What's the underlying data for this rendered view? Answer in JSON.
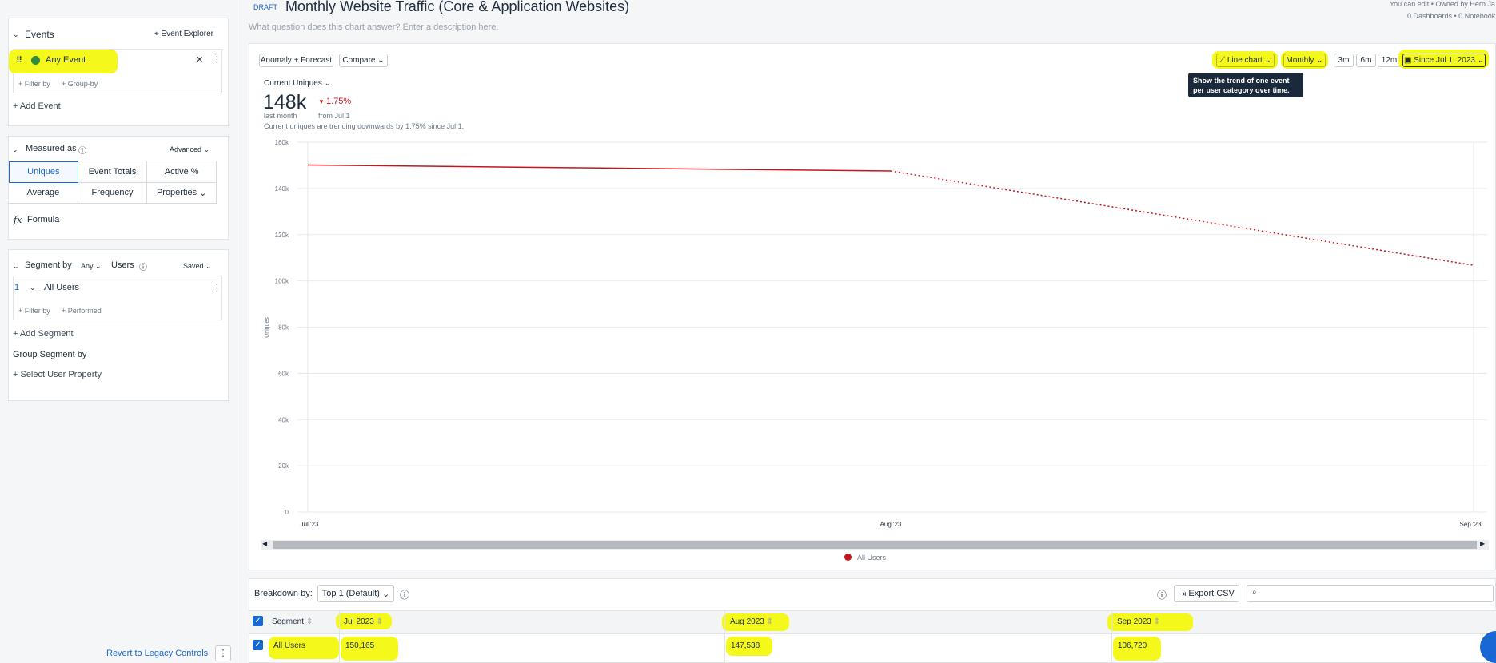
{
  "sidebar": {
    "events_title": "Events",
    "event_explorer": "Event Explorer",
    "event_name": "Any Event",
    "filter_by": "+ Filter by",
    "group_by": "+ Group-by",
    "add_event": "+ Add Event",
    "measured_as": "Measured as",
    "advanced": "Advanced",
    "measures": [
      "Uniques",
      "Event Totals",
      "Active %",
      "Average",
      "Frequency",
      "Properties"
    ],
    "formula": "Formula",
    "segment_by": "Segment by",
    "any": "Any",
    "users": "Users",
    "saved": "Saved",
    "segment_index": "1",
    "segment_name": "All Users",
    "seg_filter": "+ Filter by",
    "seg_performed": "+ Performed",
    "add_segment": "+ Add Segment",
    "group_segment_by": "Group Segment by",
    "select_user_property": "+ Select User Property",
    "revert": "Revert to Legacy Controls"
  },
  "header": {
    "status": "DRAFT",
    "title": "Monthly Website Traffic (Core & Application Websites)",
    "description_placeholder": "What question does this chart answer? Enter a description here.",
    "owner_line": "You can edit • Owned by Herb Ja",
    "counts": "0 Dashboards • 0 Notebook"
  },
  "toolbar": {
    "anomaly": "Anomaly + Forecast",
    "compare": "Compare",
    "chart_type": "Line chart",
    "interval": "Monthly",
    "ranges": [
      "3m",
      "6m",
      "12m"
    ],
    "date_range": "Since Jul 1, 2023",
    "tooltip": "Show the trend of one event per user category over time."
  },
  "metric": {
    "selector": "Current Uniques",
    "value": "148k",
    "change": "1.75%",
    "period": "last month",
    "from": "from Jul 1",
    "summary": "Current uniques are trending downwards by 1.75% since Jul 1."
  },
  "chart_data": {
    "type": "line",
    "ylabel": "Uniques",
    "ylim": [
      0,
      160000
    ],
    "yticks": [
      "0",
      "20k",
      "40k",
      "60k",
      "80k",
      "100k",
      "120k",
      "140k",
      "160k"
    ],
    "x": [
      "Jul '23",
      "Aug '23",
      "Sep '23"
    ],
    "series": [
      {
        "name": "All Users",
        "values": [
          150165,
          147538,
          106720
        ],
        "color": "#c4161c"
      }
    ],
    "grid": true,
    "legend": "bottom"
  },
  "breakdown": {
    "label": "Breakdown by:",
    "select": "Top 1 (Default)",
    "export": "Export CSV",
    "columns": [
      "Segment",
      "Jul 2023",
      "Aug 2023",
      "Sep 2023"
    ],
    "rows": [
      {
        "segment": "All Users",
        "values": [
          "150,165",
          "147,538",
          "106,720"
        ]
      }
    ]
  }
}
